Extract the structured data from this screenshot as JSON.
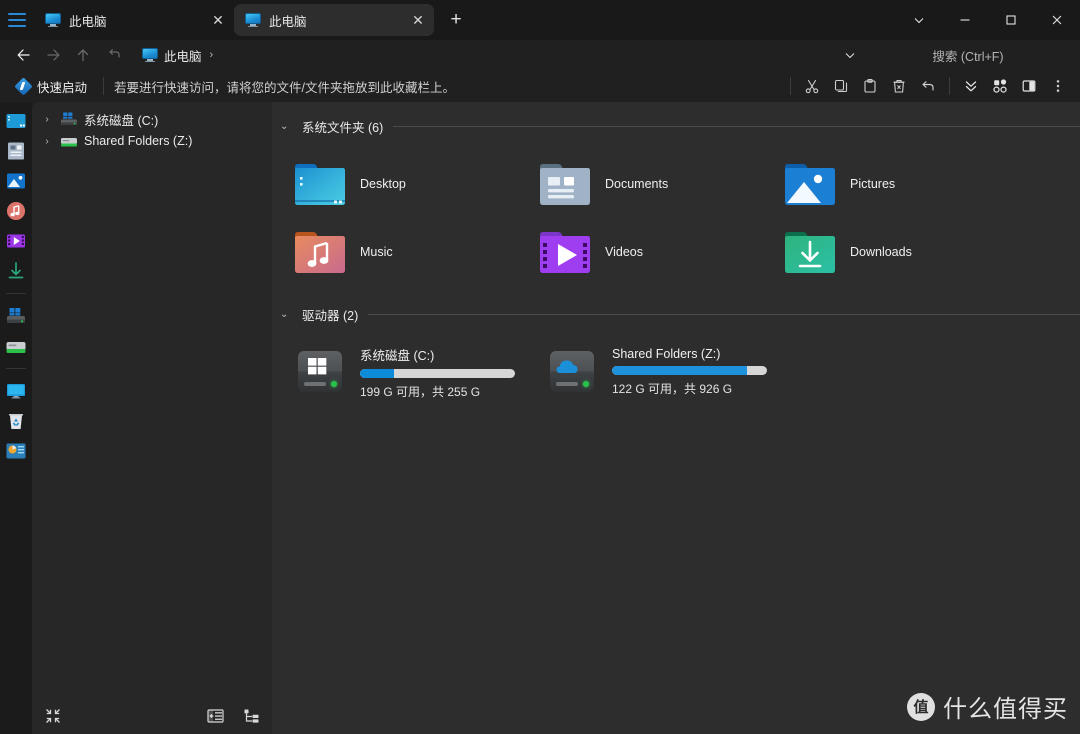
{
  "window": {
    "minimize_label": "—",
    "maximize_label": "□",
    "close_label": "✕",
    "chevron_label": "⌄"
  },
  "tabs": [
    {
      "title": "此电脑",
      "icon": "monitor-icon",
      "close_label": "✕",
      "active": false
    },
    {
      "title": "此电脑",
      "icon": "monitor-icon",
      "close_label": "✕",
      "active": true
    }
  ],
  "new_tab_label": "+",
  "address": {
    "back_label": "←",
    "forward_label": "→",
    "up_label": "↑",
    "refresh_label": "↶",
    "crumb": "此电脑",
    "crumb_sep": "›",
    "history_chevron": "⌄",
    "search_placeholder": "搜索 (Ctrl+F)"
  },
  "quickbar": {
    "label": "快速启动",
    "hint": "若要进行快速访问，请将您的文件/文件夹拖放到此收藏栏上。",
    "tools": [
      {
        "name": "cut-icon"
      },
      {
        "name": "copy-icon"
      },
      {
        "name": "paste-icon"
      },
      {
        "name": "delete-icon"
      },
      {
        "name": "undo-icon"
      },
      {
        "name": "chevron-double-down-icon"
      },
      {
        "name": "view-grid-icon"
      },
      {
        "name": "preview-pane-icon"
      },
      {
        "name": "more-options-icon"
      }
    ]
  },
  "rail": {
    "items": [
      {
        "name": "desktop-icon"
      },
      {
        "name": "documents-icon"
      },
      {
        "name": "pictures-icon"
      },
      {
        "name": "music-icon"
      },
      {
        "name": "videos-icon"
      },
      {
        "name": "downloads-icon"
      },
      {
        "name": "system-drive-icon"
      },
      {
        "name": "shared-drive-icon"
      },
      {
        "name": "this-pc-icon"
      },
      {
        "name": "recycle-bin-icon"
      },
      {
        "name": "network-icon"
      }
    ]
  },
  "tree": {
    "items": [
      {
        "label": "系统磁盘 (C:)",
        "chevron": "›",
        "icon": "system-drive-icon"
      },
      {
        "label": "Shared Folders (Z:)",
        "chevron": "›",
        "icon": "shared-drive-icon"
      }
    ],
    "bottom": {
      "collapse_label": "collapse-icon",
      "details_label": "details-view-icon",
      "tree_label": "tree-view-icon"
    }
  },
  "content": {
    "sections": [
      {
        "title": "系统文件夹 (6)",
        "chevron": "⌄",
        "items": [
          {
            "label": "Desktop",
            "icon": "desktop-folder-icon"
          },
          {
            "label": "Documents",
            "icon": "documents-folder-icon"
          },
          {
            "label": "Pictures",
            "icon": "pictures-folder-icon"
          },
          {
            "label": "Music",
            "icon": "music-folder-icon"
          },
          {
            "label": "Videos",
            "icon": "videos-folder-icon"
          },
          {
            "label": "Downloads",
            "icon": "downloads-folder-icon"
          }
        ]
      },
      {
        "title": "驱动器 (2)",
        "chevron": "⌄",
        "drives": [
          {
            "name": "系统磁盘 (C:)",
            "free_text": "199 G 可用，共 255 G",
            "used_percent": 22,
            "icon": "windows-drive-icon",
            "bar_color": "#0d8bd9"
          },
          {
            "name": "Shared Folders (Z:)",
            "free_text": "122 G 可用，共 926 G",
            "used_percent": 87,
            "icon": "cloud-drive-icon",
            "bar_color": "#1d91dc"
          }
        ]
      }
    ]
  },
  "watermark": {
    "logo": "值",
    "text": "什么值得买"
  },
  "colors": {
    "titlebar": "#191919",
    "toolbar": "#202020",
    "tree_bg": "#272727",
    "content_bg": "#2d2d2d",
    "accent": "#2b88d8",
    "bar_track": "#d6d6d6"
  }
}
